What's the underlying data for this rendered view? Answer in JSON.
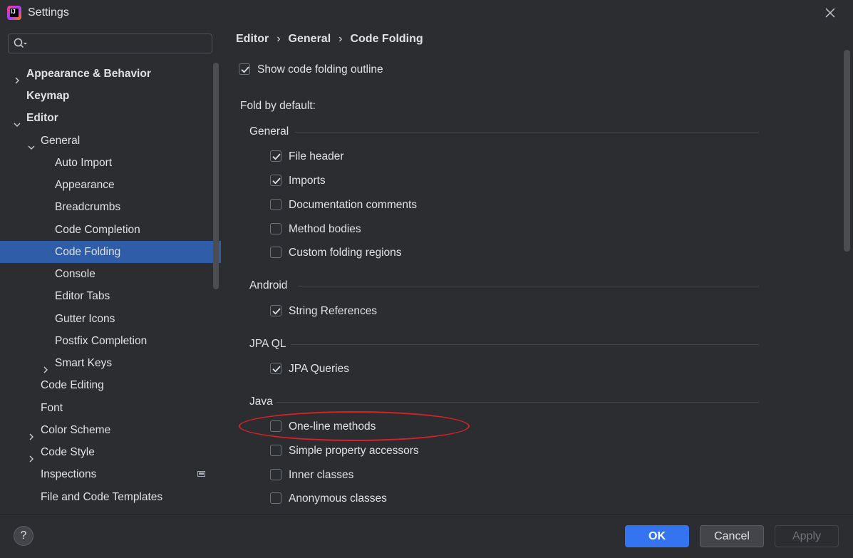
{
  "window": {
    "title": "Settings"
  },
  "search": {
    "value": "",
    "placeholder": ""
  },
  "sidebar": {
    "items": [
      {
        "label": "Appearance & Behavior",
        "level": 0,
        "bold": true,
        "chevron": "right"
      },
      {
        "label": "Keymap",
        "level": 0,
        "bold": true,
        "chevron": "none"
      },
      {
        "label": "Editor",
        "level": 0,
        "bold": true,
        "chevron": "down"
      },
      {
        "label": "General",
        "level": 1,
        "bold": false,
        "chevron": "down"
      },
      {
        "label": "Auto Import",
        "level": 2,
        "bold": false,
        "chevron": "none"
      },
      {
        "label": "Appearance",
        "level": 2,
        "bold": false,
        "chevron": "none"
      },
      {
        "label": "Breadcrumbs",
        "level": 2,
        "bold": false,
        "chevron": "none"
      },
      {
        "label": "Code Completion",
        "level": 2,
        "bold": false,
        "chevron": "none"
      },
      {
        "label": "Code Folding",
        "level": 2,
        "bold": false,
        "chevron": "none",
        "selected": true
      },
      {
        "label": "Console",
        "level": 2,
        "bold": false,
        "chevron": "none"
      },
      {
        "label": "Editor Tabs",
        "level": 2,
        "bold": false,
        "chevron": "none"
      },
      {
        "label": "Gutter Icons",
        "level": 2,
        "bold": false,
        "chevron": "none"
      },
      {
        "label": "Postfix Completion",
        "level": 2,
        "bold": false,
        "chevron": "none"
      },
      {
        "label": "Smart Keys",
        "level": 2,
        "bold": false,
        "chevron": "right"
      },
      {
        "label": "Code Editing",
        "level": 1,
        "bold": false,
        "chevron": "none"
      },
      {
        "label": "Font",
        "level": 1,
        "bold": false,
        "chevron": "none"
      },
      {
        "label": "Color Scheme",
        "level": 1,
        "bold": false,
        "chevron": "right"
      },
      {
        "label": "Code Style",
        "level": 1,
        "bold": false,
        "chevron": "right"
      },
      {
        "label": "Inspections",
        "level": 1,
        "bold": false,
        "chevron": "none",
        "icon": "project-level-icon"
      },
      {
        "label": "File and Code Templates",
        "level": 1,
        "bold": false,
        "chevron": "none"
      }
    ]
  },
  "breadcrumb": {
    "items": [
      "Editor",
      "General",
      "Code Folding"
    ],
    "separator": "›"
  },
  "content": {
    "show_outline": {
      "label": "Show code folding outline",
      "checked": true
    },
    "fold_by_default": "Fold by default:",
    "groups": [
      {
        "title": "General",
        "options": [
          {
            "label": "File header",
            "checked": true
          },
          {
            "label": "Imports",
            "checked": true
          },
          {
            "label": "Documentation comments",
            "checked": false
          },
          {
            "label": "Method bodies",
            "checked": false
          },
          {
            "label": "Custom folding regions",
            "checked": false
          }
        ]
      },
      {
        "title": "Android",
        "options": [
          {
            "label": "String References",
            "checked": true
          }
        ]
      },
      {
        "title": "JPA QL",
        "options": [
          {
            "label": "JPA Queries",
            "checked": true
          }
        ]
      },
      {
        "title": "Java",
        "options": [
          {
            "label": "One-line methods",
            "checked": false
          },
          {
            "label": "Simple property accessors",
            "checked": false
          },
          {
            "label": "Inner classes",
            "checked": false
          },
          {
            "label": "Anonymous classes",
            "checked": false
          }
        ]
      }
    ]
  },
  "footer": {
    "help": "?",
    "ok": "OK",
    "cancel": "Cancel",
    "apply": "Apply"
  },
  "colors": {
    "background": "#2b2d30",
    "selection": "#2f5da8",
    "accent": "#3574f0",
    "annotation": "#d8202a"
  }
}
